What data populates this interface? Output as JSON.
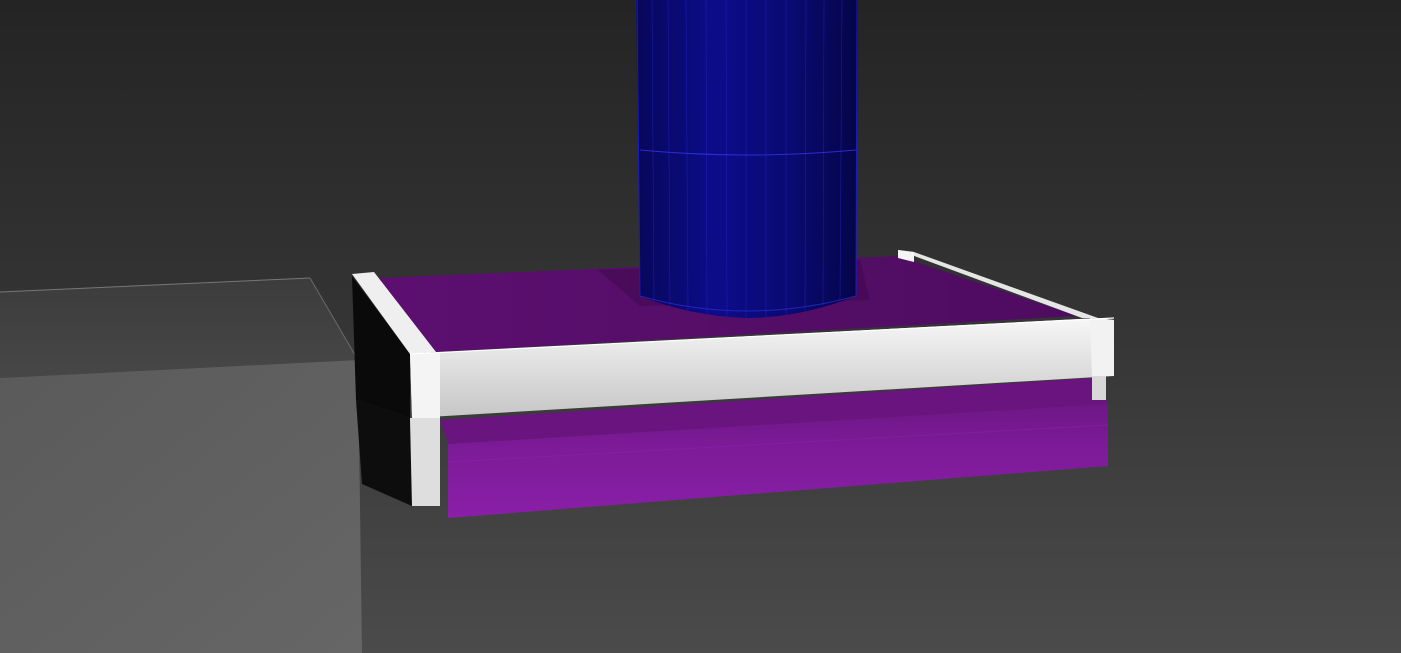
{
  "viewport": {
    "background_top": "#262626",
    "background_bottom": "#4a4a4a"
  },
  "colors": {
    "column_fill": "#0a0a7a",
    "column_wire": "#2a2aff",
    "platform_top": "#5b0f6e",
    "platform_underside": "#7a1a95",
    "frame_light": "#f0f0f0",
    "frame_shadow": "#111111",
    "block_top": "#3f3f3f",
    "block_front": "#565656"
  }
}
